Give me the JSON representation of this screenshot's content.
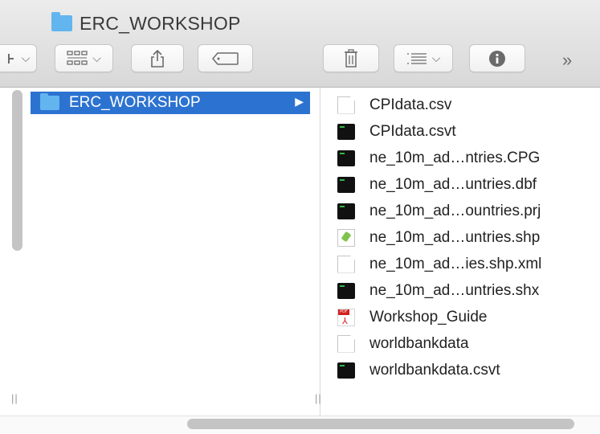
{
  "window": {
    "title": "ERC_WORKSHOP"
  },
  "toolbar": {
    "more_glyph": "»"
  },
  "column1": {
    "selected_item": {
      "label": "ERC_WORKSHOP",
      "icon": "folder-icon"
    }
  },
  "column2": {
    "files": [
      {
        "name": "CPIdata.csv",
        "icon": "document-icon"
      },
      {
        "name": "CPIdata.csvt",
        "icon": "executable-icon"
      },
      {
        "name": "ne_10m_ad…ntries.CPG",
        "icon": "executable-icon"
      },
      {
        "name": "ne_10m_ad…untries.dbf",
        "icon": "executable-icon"
      },
      {
        "name": "ne_10m_ad…ountries.prj",
        "icon": "executable-icon"
      },
      {
        "name": "ne_10m_ad…untries.shp",
        "icon": "shp-icon"
      },
      {
        "name": "ne_10m_ad…ies.shp.xml",
        "icon": "document-icon"
      },
      {
        "name": "ne_10m_ad…untries.shx",
        "icon": "executable-icon"
      },
      {
        "name": "Workshop_Guide",
        "icon": "pdf-icon"
      },
      {
        "name": "worldbankdata",
        "icon": "document-icon"
      },
      {
        "name": "worldbankdata.csvt",
        "icon": "executable-icon"
      }
    ]
  },
  "colors": {
    "selection": "#2c73d1",
    "folder": "#62b5ef",
    "toolbar_bg": "#e2e2e2"
  }
}
